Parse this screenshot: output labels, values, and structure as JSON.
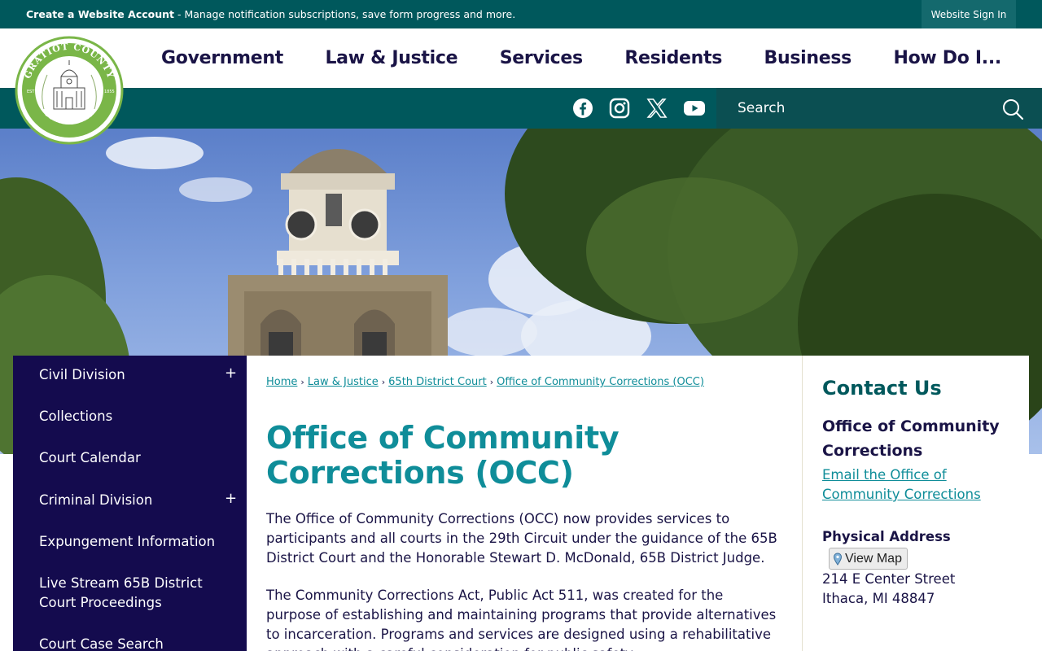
{
  "topbar": {
    "account_link": "Create a Website Account",
    "account_desc": " - Manage notification subscriptions, save form progress and more.",
    "signin": "Website Sign In"
  },
  "logo": {
    "top_text": "GRATIOT COUNTY",
    "bottom_text": "MICHIGAN",
    "est_left": "EST",
    "est_right": "1855"
  },
  "nav": {
    "items": [
      "Government",
      "Law & Justice",
      "Services",
      "Residents",
      "Business",
      "How Do I..."
    ]
  },
  "social": {
    "icons": [
      "facebook-icon",
      "instagram-icon",
      "x-icon",
      "youtube-icon"
    ]
  },
  "search": {
    "placeholder": "Search"
  },
  "sidebar": {
    "items": [
      {
        "label": "Civil Division",
        "expand": "+"
      },
      {
        "label": "Collections"
      },
      {
        "label": "Court Calendar"
      },
      {
        "label": "Criminal Division",
        "expand": "+"
      },
      {
        "label": "Expungement Information"
      },
      {
        "label": "Live Stream 65B District Court Proceedings"
      },
      {
        "label": "Court Case Search"
      }
    ]
  },
  "breadcrumb": {
    "items": [
      "Home",
      "Law & Justice",
      "65th District Court",
      "Office of Community Corrections (OCC)"
    ],
    "separator": "›"
  },
  "main": {
    "title": "Office of Community Corrections (OCC)",
    "paragraphs": [
      "The Office of Community Corrections (OCC) now provides services to participants and all courts in the 29th Circuit under the guidance of the 65B District Court and the Honorable Stewart D. McDonald, 65B District Judge.",
      "The Community Corrections Act, Public Act 511, was created for the purpose of establishing and maintaining programs that provide alternatives to incarceration. Programs and services are designed using a rehabilitative approach with a careful consideration for public safety."
    ]
  },
  "contact": {
    "title": "Contact Us",
    "org": "Office of Community Corrections",
    "email_link": "Email the Office of Community Corrections",
    "address_label": "Physical Address",
    "view_map": "View Map",
    "street": "214 E Center Street",
    "city": "Ithaca, MI 48847"
  },
  "colors": {
    "teal_dark": "#00585c",
    "navy": "#140b4e",
    "accent_teal": "#0f8d99",
    "logo_green": "#7ab648"
  }
}
